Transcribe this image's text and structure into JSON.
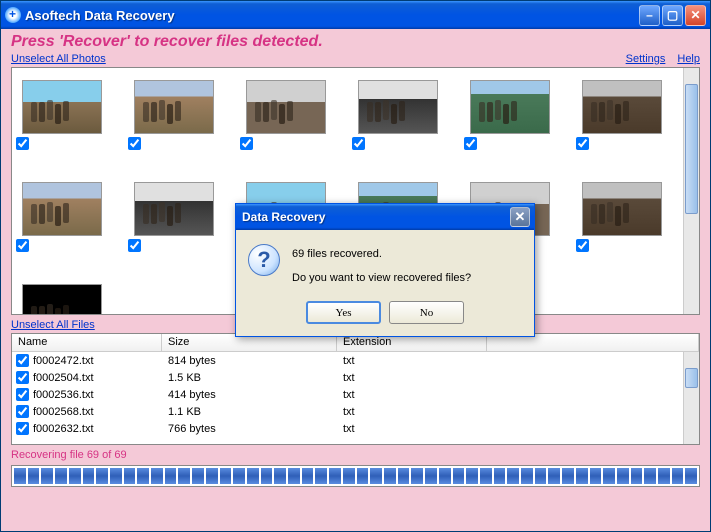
{
  "window": {
    "title": "Asoftech Data Recovery"
  },
  "instructions": "Press 'Recover' to recover files detected.",
  "links": {
    "unselect_photos": "Unselect All Photos",
    "unselect_files": "Unselect All Files",
    "settings": "Settings",
    "help": "Help"
  },
  "photos": [
    {
      "checked": true
    },
    {
      "checked": true
    },
    {
      "checked": true
    },
    {
      "checked": true
    },
    {
      "checked": true
    },
    {
      "checked": true
    },
    {
      "checked": true
    },
    {
      "checked": true
    },
    {
      "checked": true
    },
    {
      "checked": true
    },
    {
      "checked": true
    },
    {
      "checked": true
    },
    {
      "checked": true
    }
  ],
  "file_headers": {
    "name": "Name",
    "size": "Size",
    "ext": "Extension"
  },
  "files": [
    {
      "name": "f0002472.txt",
      "size": "814 bytes",
      "ext": "txt",
      "checked": true
    },
    {
      "name": "f0002504.txt",
      "size": "1.5 KB",
      "ext": "txt",
      "checked": true
    },
    {
      "name": "f0002536.txt",
      "size": "414 bytes",
      "ext": "txt",
      "checked": true
    },
    {
      "name": "f0002568.txt",
      "size": "1.1 KB",
      "ext": "txt",
      "checked": true
    },
    {
      "name": "f0002632.txt",
      "size": "766 bytes",
      "ext": "txt",
      "checked": true
    }
  ],
  "status": "Recovering file 69 of 69",
  "progress_segments": 50,
  "dialog": {
    "title": "Data Recovery",
    "line1": "69 files recovered.",
    "line2": "Do you want to view recovered files?",
    "yes": "Yes",
    "no": "No"
  }
}
